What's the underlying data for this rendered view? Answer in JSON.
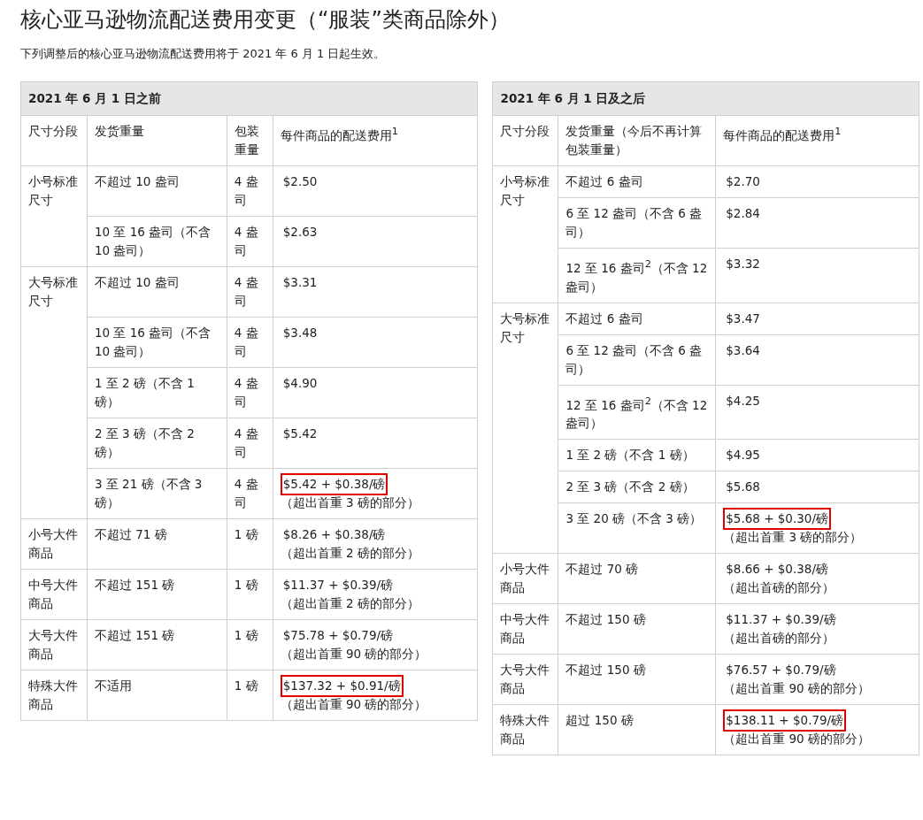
{
  "title": "核心亚马逊物流配送费用变更（“服装”类商品除外）",
  "intro": "下列调整后的核心亚马逊物流配送费用将于 2021 年 6 月 1 日起生效。",
  "tables": [
    {
      "heading": "2021 年 6 月 1 日之前",
      "columns": [
        "尺寸分段",
        "发货重量",
        "包装重量",
        "每件商品的配送费用$^{1}$"
      ],
      "groups": [
        {
          "tier": "小号标准尺寸",
          "rows": [
            {
              "weight": "不超过 10 盎司",
              "packaging": "4 盎司",
              "fee": {
                "amount": "$2.50",
                "highlighted": false
              }
            },
            {
              "weight": "10 至 16 盎司（不含 10 盎司）",
              "packaging": "4 盎司",
              "fee": {
                "amount": "$2.63",
                "highlighted": false
              }
            }
          ]
        },
        {
          "tier": "大号标准尺寸",
          "rows": [
            {
              "weight": "不超过 10 盎司",
              "packaging": "4 盎司",
              "fee": {
                "amount": "$3.31",
                "highlighted": false
              }
            },
            {
              "weight": "10 至 16 盎司（不含 10 盎司）",
              "packaging": "4 盎司",
              "fee": {
                "amount": "$3.48",
                "highlighted": false
              }
            },
            {
              "weight": "1 至 2 磅（不含 1 磅）",
              "packaging": "4 盎司",
              "fee": {
                "amount": "$4.90",
                "highlighted": false
              }
            },
            {
              "weight": "2 至 3 磅（不含 2 磅）",
              "packaging": "4 盎司",
              "fee": {
                "amount": "$5.42",
                "highlighted": false
              }
            },
            {
              "weight": "3 至 21 磅（不含 3 磅）",
              "packaging": "4 盎司",
              "fee": {
                "amount": "$5.42 + $0.38/磅",
                "note": "（超出首重 3 磅的部分）",
                "highlighted": true
              }
            }
          ]
        },
        {
          "tier": "小号大件商品",
          "rows": [
            {
              "weight": "不超过 71 磅",
              "packaging": "1 磅",
              "fee": {
                "amount": "$8.26 + $0.38/磅",
                "note": "（超出首重 2 磅的部分）",
                "highlighted": false
              }
            }
          ]
        },
        {
          "tier": "中号大件商品",
          "rows": [
            {
              "weight": "不超过 151 磅",
              "packaging": "1 磅",
              "fee": {
                "amount": "$11.37 + $0.39/磅",
                "note": "（超出首重 2 磅的部分）",
                "highlighted": false
              }
            }
          ]
        },
        {
          "tier": "大号大件商品",
          "rows": [
            {
              "weight": "不超过 151 磅",
              "packaging": "1 磅",
              "fee": {
                "amount": "$75.78 + $0.79/磅",
                "note": "（超出首重 90 磅的部分）",
                "highlighted": false
              }
            }
          ]
        },
        {
          "tier": "特殊大件商品",
          "rows": [
            {
              "weight": "不适用",
              "packaging": "1 磅",
              "fee": {
                "amount": "$137.32 + $0.91/磅",
                "note": "（超出首重 90 磅的部分）",
                "highlighted": true
              }
            }
          ]
        }
      ]
    },
    {
      "heading": "2021 年 6 月 1 日及之后",
      "columns": [
        "尺寸分段",
        "发货重量（今后不再计算包装重量）",
        "每件商品的配送费用$^{1}$"
      ],
      "groups": [
        {
          "tier": "小号标准尺寸",
          "rows": [
            {
              "weight": "不超过 6 盎司",
              "fee": {
                "amount": "$2.70",
                "highlighted": false
              }
            },
            {
              "weight": "6 至 12 盎司（不含 6 盎司）",
              "fee": {
                "amount": "$2.84",
                "highlighted": false
              }
            },
            {
              "weight": "12 至 16 盎司$^{2}$（不含 12 盎司）",
              "fee": {
                "amount": "$3.32",
                "highlighted": false
              }
            }
          ]
        },
        {
          "tier": "大号标准尺寸",
          "rows": [
            {
              "weight": "不超过 6 盎司",
              "fee": {
                "amount": "$3.47",
                "highlighted": false
              }
            },
            {
              "weight": "6 至 12 盎司（不含 6 盎司）",
              "fee": {
                "amount": "$3.64",
                "highlighted": false
              }
            },
            {
              "weight": "12 至 16 盎司$^{2}$（不含 12 盎司）",
              "fee": {
                "amount": "$4.25",
                "highlighted": false
              }
            },
            {
              "weight": "1 至 2 磅（不含 1 磅）",
              "fee": {
                "amount": "$4.95",
                "highlighted": false
              }
            },
            {
              "weight": "2 至 3 磅（不含 2 磅）",
              "fee": {
                "amount": "$5.68",
                "highlighted": false
              }
            },
            {
              "weight": "3 至 20 磅（不含 3 磅）",
              "fee": {
                "amount": "$5.68 + $0.30/磅",
                "note": "（超出首重 3 磅的部分）",
                "highlighted": true
              }
            }
          ]
        },
        {
          "tier": "小号大件商品",
          "rows": [
            {
              "weight": "不超过 70 磅",
              "fee": {
                "amount": "$8.66 + $0.38/磅",
                "note": "（超出首磅的部分）",
                "highlighted": false
              }
            }
          ]
        },
        {
          "tier": "中号大件商品",
          "rows": [
            {
              "weight": "不超过 150 磅",
              "fee": {
                "amount": "$11.37 + $0.39/磅",
                "note": "（超出首磅的部分）",
                "highlighted": false
              }
            }
          ]
        },
        {
          "tier": "大号大件商品",
          "rows": [
            {
              "weight": "不超过 150 磅",
              "fee": {
                "amount": "$76.57 + $0.79/磅",
                "note": "（超出首重 90 磅的部分）",
                "highlighted": false
              }
            }
          ]
        },
        {
          "tier": "特殊大件商品",
          "rows": [
            {
              "weight": "超过 150 磅",
              "fee": {
                "amount": "$138.11 + $0.79/磅",
                "note": "（超出首重 90 磅的部分）",
                "highlighted": true
              }
            }
          ]
        }
      ]
    }
  ]
}
